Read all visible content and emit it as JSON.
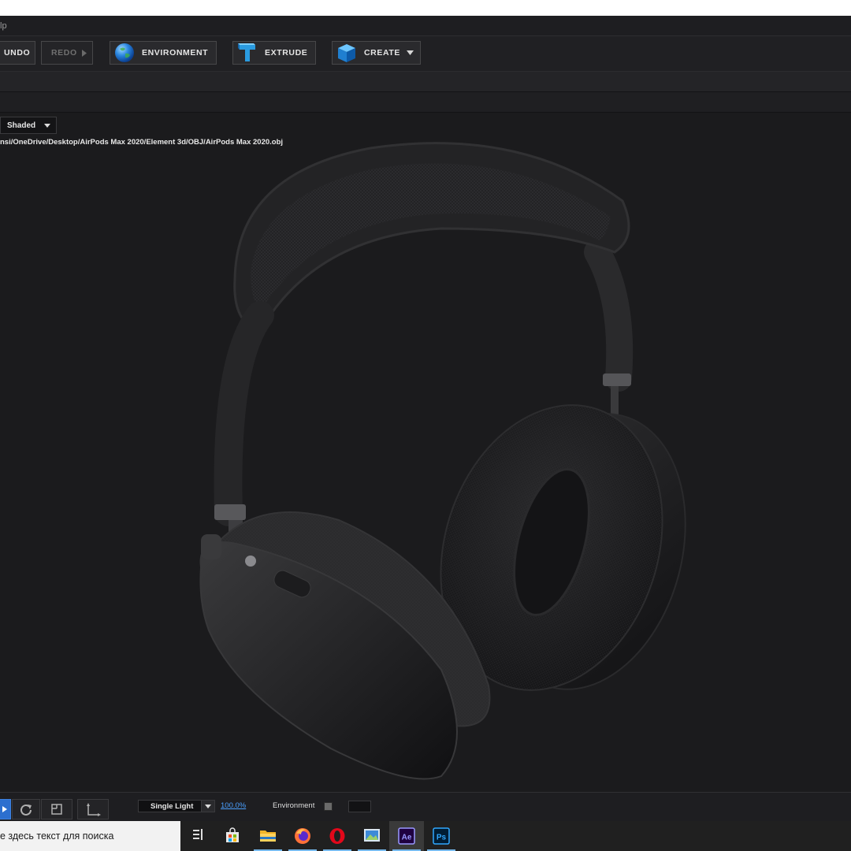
{
  "menubar": {
    "partial_text": "lp"
  },
  "toolbar": {
    "undo_label": "UNDO",
    "redo_label": "REDO",
    "environment_label": "ENVIRONMENT",
    "extrude_label": "EXTRUDE",
    "create_label": "CREATE"
  },
  "viewport": {
    "render_mode": "Shaded",
    "file_path": "nsi/OneDrive/Desktop/AirPods Max 2020/Element 3d/OBJ/AirPods Max 2020.obj",
    "model_icon": "headphones-model"
  },
  "bottom_bar": {
    "light_mode": "Single Light",
    "zoom": "100.0%",
    "environment_label": "Environment"
  },
  "taskbar": {
    "search_placeholder": "е здесь текст для поиска",
    "apps": [
      "task-view",
      "store",
      "file-explorer",
      "firefox",
      "opera",
      "photos",
      "after-effects",
      "photoshop"
    ],
    "ae_label": "Ae",
    "ps_label": "Ps"
  },
  "colors": {
    "viewport_bg": "#1b1b1d",
    "accent_blue": "#2c6fcf",
    "link_blue": "#4aa0ff",
    "taskbar_bg": "#202020"
  }
}
